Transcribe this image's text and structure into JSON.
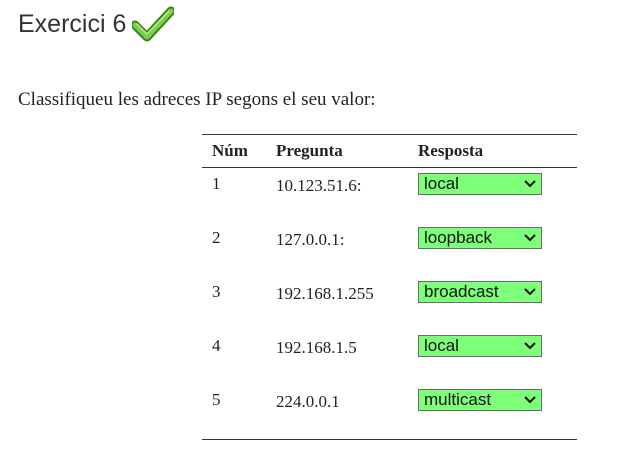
{
  "page": {
    "title": "Exercici 6",
    "status_icon": "checkmark-icon",
    "intro": "Classifiqueu les adreces IP segons el seu valor:"
  },
  "table": {
    "headers": {
      "num": "Núm",
      "pregunta": "Pregunta",
      "resposta": "Resposta"
    },
    "rows": [
      {
        "num": "1",
        "question": "10.123.51.6:",
        "answer": "local"
      },
      {
        "num": "2",
        "question": "127.0.0.1:",
        "answer": "loopback"
      },
      {
        "num": "3",
        "question": "192.168.1.255",
        "answer": "broadcast"
      },
      {
        "num": "4",
        "question": "192.168.1.5",
        "answer": "local"
      },
      {
        "num": "5",
        "question": "224.0.0.1",
        "answer": "multicast"
      }
    ]
  },
  "colors": {
    "select_background": "#7dff7a",
    "check_green": "#5fb832"
  }
}
